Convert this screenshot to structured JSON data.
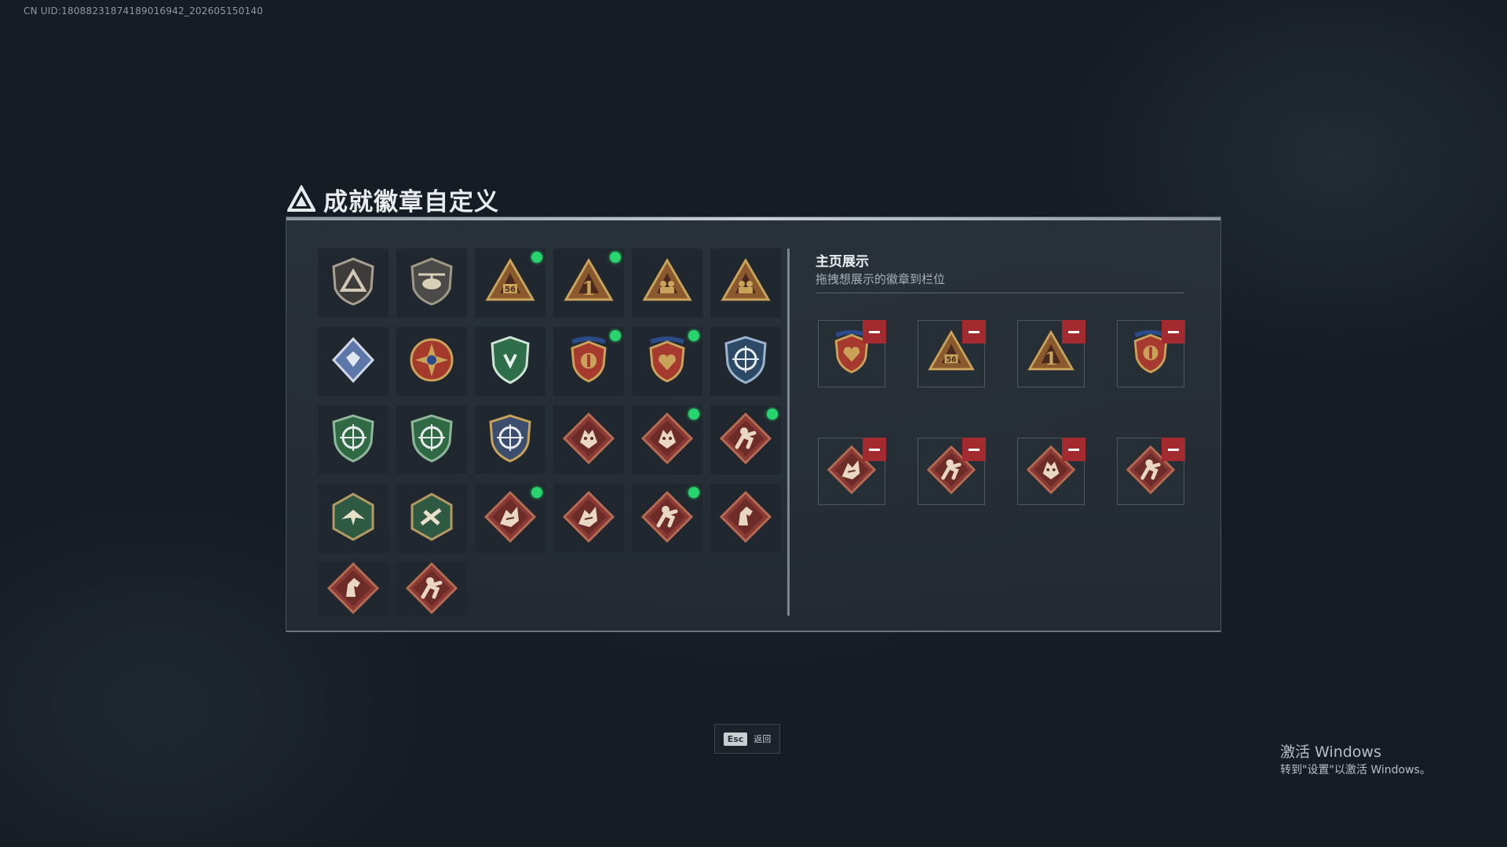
{
  "uid_text": "CN UID:18088231874189016942_202605150140",
  "title": "成就徽章自定义",
  "sidebar": {
    "title": "主页展示",
    "subtitle": "拖拽想展示的徽章到栏位"
  },
  "badges": [
    {
      "icon": "shield-triangle",
      "is_new": false
    },
    {
      "icon": "helicopter-shield",
      "is_new": false
    },
    {
      "icon": "triangle-56",
      "is_new": true
    },
    {
      "icon": "triangle-1",
      "is_new": true
    },
    {
      "icon": "triangle-soldiers",
      "is_new": false
    },
    {
      "icon": "triangle-soldiers-flag",
      "is_new": false
    },
    {
      "icon": "blue-diamond",
      "is_new": false
    },
    {
      "icon": "star-compass",
      "is_new": false
    },
    {
      "icon": "green-shield",
      "is_new": false
    },
    {
      "icon": "red-shield-medal",
      "is_new": true
    },
    {
      "icon": "red-shield-heart",
      "is_new": true
    },
    {
      "icon": "blue-crosshair-shield",
      "is_new": false
    },
    {
      "icon": "green-crosshair-shield",
      "is_new": false
    },
    {
      "icon": "green-crosshair-shield-2",
      "is_new": false
    },
    {
      "icon": "gold-crosshair-shield",
      "is_new": false
    },
    {
      "icon": "diamond-wolf",
      "is_new": false
    },
    {
      "icon": "diamond-tiger",
      "is_new": true
    },
    {
      "icon": "diamond-runner",
      "is_new": true
    },
    {
      "icon": "hex-eagle",
      "is_new": false
    },
    {
      "icon": "hex-drone",
      "is_new": false
    },
    {
      "icon": "diamond-dragon",
      "is_new": true
    },
    {
      "icon": "diamond-dragon-2",
      "is_new": false
    },
    {
      "icon": "diamond-runner-2",
      "is_new": true
    },
    {
      "icon": "diamond-horse",
      "is_new": false
    },
    {
      "icon": "diamond-horse-2",
      "is_new": false
    },
    {
      "icon": "diamond-runner-3",
      "is_new": false
    }
  ],
  "slots": [
    {
      "icon": "red-shield-heart"
    },
    {
      "icon": "triangle-56"
    },
    {
      "icon": "triangle-1"
    },
    {
      "icon": "red-shield-medal"
    },
    {
      "icon": "diamond-dragon"
    },
    {
      "icon": "diamond-runner"
    },
    {
      "icon": "diamond-tiger"
    },
    {
      "icon": "diamond-runner-2"
    }
  ],
  "esc": {
    "key": "Esc",
    "label": "返回"
  },
  "windows": {
    "line1": "激活 Windows",
    "line2": "转到\"设置\"以激活 Windows。"
  },
  "colors": {
    "new_dot": "#27d46e",
    "remove": "#a32a2e",
    "gold": "#c9a35a",
    "red_badge": "#8a3a34"
  }
}
